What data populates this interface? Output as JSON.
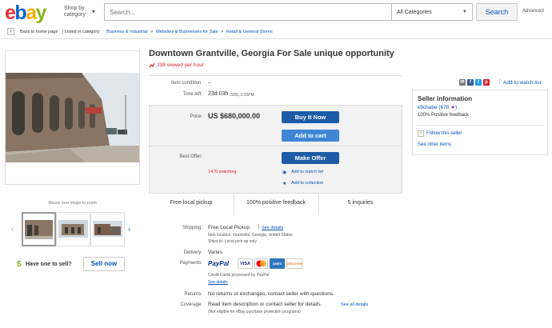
{
  "header": {
    "logo_letters": [
      "e",
      "b",
      "a",
      "y"
    ],
    "logo_colors": [
      "#e53238",
      "#0064d2",
      "#f5af02",
      "#86b817"
    ],
    "shop_by": "Shop by category",
    "search_placeholder": "Search...",
    "category": "All Categories",
    "search_button": "Search",
    "advanced": "Advanced"
  },
  "breadcrumb": {
    "back": "Back to home page",
    "listed_in": "| Listed in category:",
    "items": [
      "Business & Industrial",
      ">",
      "Websites & Businesses for Sale",
      ">",
      "Retail & General Stores"
    ]
  },
  "gallery": {
    "zoom_hint": "Mouse over image to zoom",
    "prev_icon": "‹",
    "next_icon": "›"
  },
  "sell": {
    "text": "Have one to sell?",
    "button": "Sell now"
  },
  "item": {
    "title": "Downtown Grantville, Georgia For Sale unique opportunity",
    "viewed": "238 viewed per hour",
    "condition_label": "Item condition:",
    "condition_value": "--",
    "time_left_label": "Time left:",
    "time_left_value": "23d 03h",
    "time_left_date": "3/26, 2:22PM",
    "price_label": "Price:",
    "price": "US $680,000.00",
    "buy_now": "Buy It Now",
    "add_to_cart": "Add to cart",
    "best_offer_label": "Best Offer:",
    "make_offer": "Make Offer",
    "watching": "1470 watching",
    "add_watch": "Add to watch list",
    "add_collection": "Add to collection",
    "stats": [
      "Free local pickup",
      "100% positive feedback",
      "5 inquiries"
    ]
  },
  "details": {
    "shipping_label": "Shipping:",
    "shipping_value": "Free Local Pickup",
    "see_details": "See details",
    "item_location": "Item location:  Grantville, Georgia, United States",
    "ships_to": "Ships to:  Local pick-up only",
    "delivery_label": "Delivery:",
    "delivery_value": "Varies",
    "payments_label": "Payments:",
    "paypal": "PayPal",
    "cards": [
      "VISA",
      "MC",
      "AMEX",
      "DISCOVER"
    ],
    "credit_note": "Credit Cards processed by PayPal",
    "see_details_2": "See details",
    "returns_label": "Returns:",
    "returns_value": "No returns or exchanges, contact seller with questions.",
    "coverage_label": "Coverage:",
    "coverage_value": "Read item description or contact seller for details.",
    "see_all": "See all details",
    "coverage_note": "(Not eligible for eBay purchase protection programs)"
  },
  "seller": {
    "add_watch": "Add to watch list",
    "title": "Seller information",
    "name": "k9chabe",
    "score": "(678",
    "score_close": ")",
    "feedback": "100% Positive feedback",
    "follow": "Follow this seller",
    "see_other": "See other items"
  },
  "colors": {
    "link": "#0654ba",
    "red": "#dd1e31",
    "buy_button": "#1e5ba6",
    "cart_button": "#3f87d6"
  }
}
